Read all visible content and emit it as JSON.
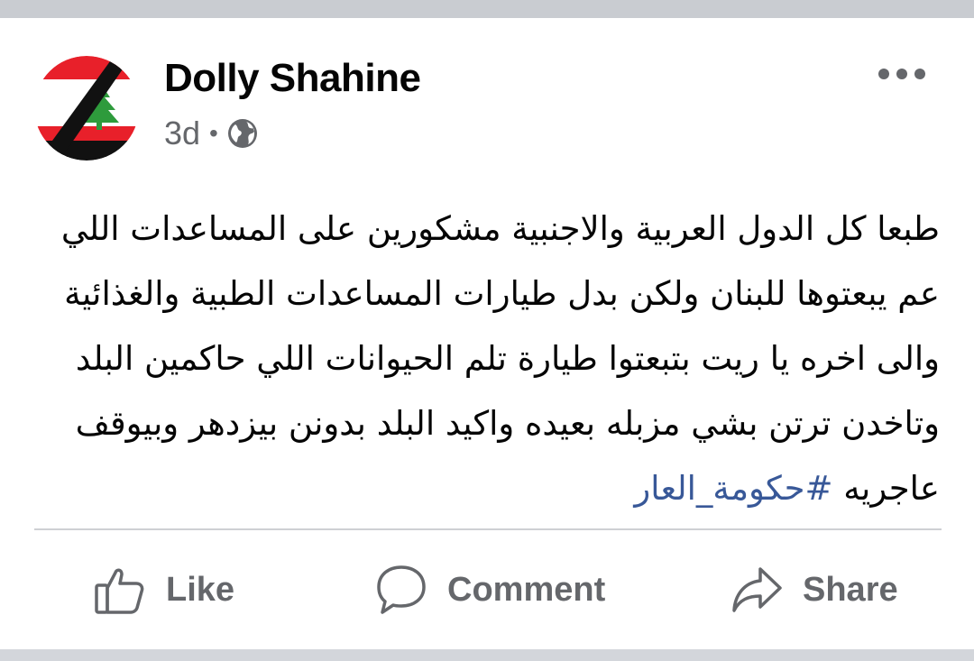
{
  "post": {
    "author": "Dolly Shahine",
    "time": "3d",
    "separator": "•",
    "privacy_icon": "globe-icon",
    "avatar_icon": "lebanon-flag-mourning-ribbon-avatar",
    "text_main": "طبعا كل الدول العربية والاجنبية مشكورين على المساعدات اللي عم يبعتوها للبنان ولكن بدل طيارات المساعدات الطبية والغذائية والى اخره يا ريت بتبعتوا طيارة تلم الحيوانات اللي حاكمين البلد وتاخدن ترتن بشي مزبله بعيده واكيد البلد بدونن بيزدهر وبيوقف عاجريه",
    "hashtag": "#حكومة_العار"
  },
  "actions": {
    "like": "Like",
    "comment": "Comment",
    "share": "Share"
  },
  "colors": {
    "text": "#050505",
    "secondary": "#65676b",
    "link": "#385898",
    "background": "#ffffff",
    "divider": "#ced0d4"
  }
}
